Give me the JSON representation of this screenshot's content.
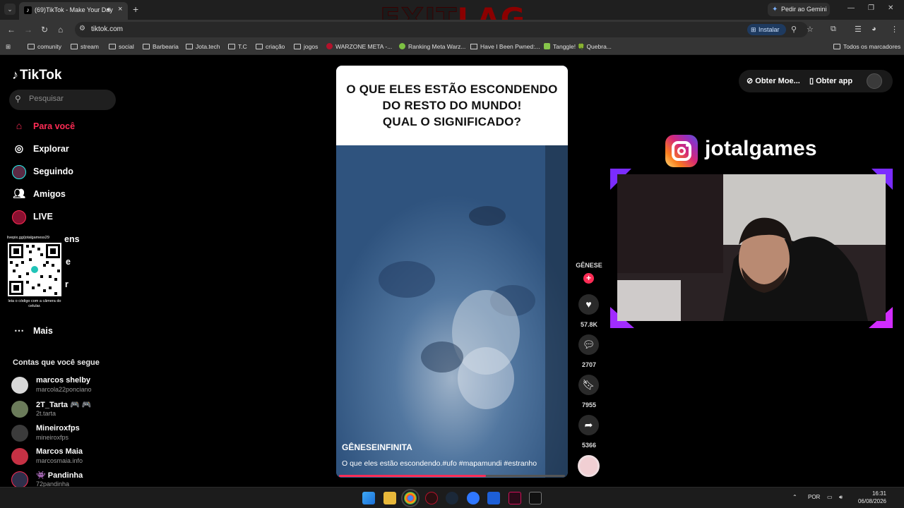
{
  "browser": {
    "tab": {
      "title": "(69)TikTok - Make Your Day",
      "icon": "tiktok-icon"
    },
    "gemini_label": "Pedir ao Gemini",
    "url": "tiktok.com",
    "install_label": "Instalar",
    "bookmarks": [
      "comunity",
      "stream",
      "social",
      "Barbearia",
      "Jota.tech",
      "T.C",
      "criação",
      "jogos",
      "WARZONE META -...",
      "Ranking Meta Warz...",
      "Have I Been Pwned:...",
      "Tanggle! 🍀 Quebra..."
    ],
    "all_bookmarks_label": "Todos os marcadores"
  },
  "overlay": {
    "exitlag_a": "EXIT",
    "exitlag_b": "LAG",
    "instagram_handle": "jotalgames",
    "qr_url": "livepix.gg/jotalgamess29",
    "qr_caption": "leia o código com a câmera do celular."
  },
  "tiktok": {
    "logo": "TikTok",
    "search_placeholder": "Pesquisar",
    "nav": [
      {
        "label": "Para você",
        "icon": "home-icon",
        "active": true
      },
      {
        "label": "Explorar",
        "icon": "compass-icon"
      },
      {
        "label": "Seguindo",
        "icon": "following-avatar-icon"
      },
      {
        "label": "Amigos",
        "icon": "friends-icon"
      },
      {
        "label": "LIVE",
        "icon": "live-icon"
      },
      {
        "label": "ens",
        "icon": "messages-icon"
      },
      {
        "label": "e",
        "icon": "upload-icon"
      },
      {
        "label": "r",
        "icon": "profile-icon"
      },
      {
        "label": "Mais",
        "icon": "more-icon"
      }
    ],
    "following_heading": "Contas que você segue",
    "following": [
      {
        "name": "marcos shelby",
        "user": "marcola22ponciano"
      },
      {
        "name": "2T_Tarta 🎮 🎮",
        "user": "2t.tarta"
      },
      {
        "name": "Mineiroxfps",
        "user": "mineiroxfps"
      },
      {
        "name": "Marcos Maia",
        "user": "marcosmaia.info"
      },
      {
        "name": "👾 Pandinha",
        "user": "72pandinha"
      }
    ],
    "topbar": {
      "coins_label": "Obter Moe...",
      "app_label": "Obter app"
    },
    "video": {
      "banner_lines": [
        "O QUE ELES ESTÃO ESCONDENDO",
        "DO RESTO DO MUNDO!",
        "QUAL O SIGNIFICADO?"
      ],
      "author": "GÊNESEINFINITA",
      "description": "O que eles estão escondendo.#ufo #mapamundi #estranho",
      "progress": 0.65
    },
    "creator_label": "GÊNESE",
    "actions": {
      "likes": "57.8K",
      "comments": "2707",
      "saves": "7955",
      "shares": "5366"
    }
  },
  "taskbar": {
    "language": "POR",
    "time": "16:31",
    "date": "06/08/2026"
  }
}
